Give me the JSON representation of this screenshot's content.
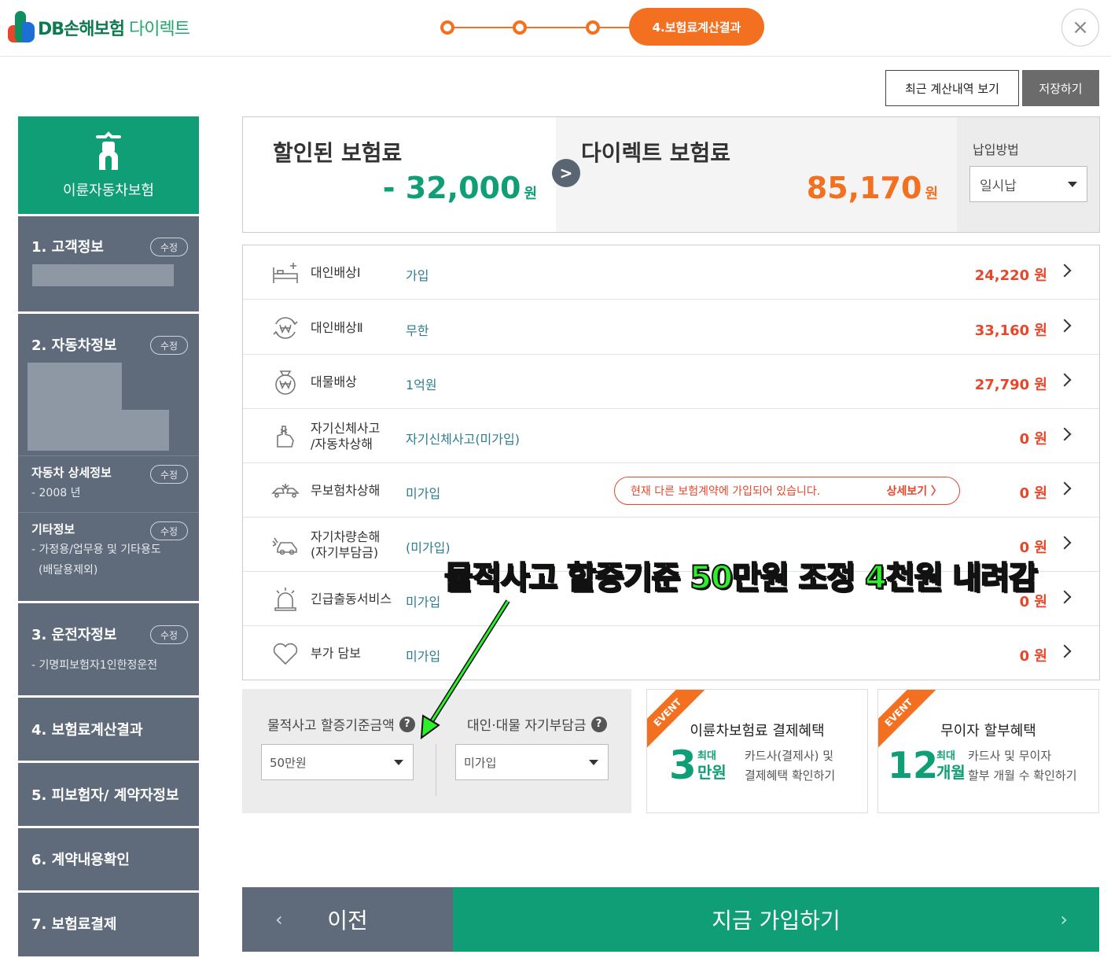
{
  "header": {
    "logo_main": "DB손해보험",
    "logo_sub": "다이렉트",
    "current_step": "4.보험료계산결과",
    "close_label": "×"
  },
  "toolbar": {
    "recent_label": "최근 계산내역 보기",
    "save_label": "저장하기"
  },
  "sidebar": {
    "head_title": "이륜자동차보험",
    "edit_label": "수정",
    "sections": {
      "customer": "1. 고객정보",
      "vehicle": "2. 자동차정보",
      "vehicle_detail": "자동차 상세정보",
      "vehicle_year": "- 2008 년",
      "other": "기타정보",
      "other_line1": "- 가정용/업무용 및 기타용도",
      "other_line2": "(배달용제외)",
      "driver": "3. 운전자정보",
      "driver_value": "- 기명피보험자1인한정운전",
      "result": "4. 보험료계산결과",
      "insured": "5. 피보험자/ 계약자정보",
      "confirm": "6. 계약내용확인",
      "payment": "7. 보험료결제"
    }
  },
  "summary": {
    "discount_label": "할인된 보험료",
    "discount_amount": "- 32,000",
    "direct_label": "다이렉트 보험료",
    "direct_amount": "85,170",
    "unit": "원",
    "arrow": ">",
    "pay_method_label": "납입방법",
    "pay_method_value": "일시납"
  },
  "coverages": [
    {
      "name": "대인배상Ⅰ",
      "value": "가입",
      "amount": "24,220 원",
      "icon": "bed-plus-icon"
    },
    {
      "name": "대인배상Ⅱ",
      "value": "무한",
      "amount": "33,160 원",
      "icon": "won-cycle-icon"
    },
    {
      "name": "대물배상",
      "value": "1억원",
      "amount": "27,790 원",
      "icon": "money-bag-icon"
    },
    {
      "name_line1": "자기신체사고",
      "name_line2": "/자동차상해",
      "value": "자기신체사고(미가입)",
      "amount": "0 원",
      "icon": "hand-bandage-icon"
    },
    {
      "name": "무보험차상해",
      "value": "미가입",
      "amount": "0 원",
      "icon": "car-crash-icon",
      "notice": "현재 다른 보험계약에 가입되어 있습니다.",
      "notice_more": "상세보기 〉"
    },
    {
      "name_line1": "자기차량손해",
      "name_line2": "(자기부담금)",
      "value": "(미가입)",
      "amount": "0 원",
      "icon": "car-damage-icon"
    },
    {
      "name": "긴급출동서비스",
      "value": "미가입",
      "amount": "0 원",
      "icon": "siren-icon"
    },
    {
      "name": "부가 담보",
      "value": "미가입",
      "amount": "0 원",
      "icon": "heart-icon"
    }
  ],
  "options": {
    "property_label": "물적사고 할증기준금액",
    "property_value": "50만원",
    "deductible_label": "대인·대물 자기부담금",
    "deductible_value": "미가입",
    "help": "?"
  },
  "events": [
    {
      "ribbon": "EVENT",
      "title": "이륜차보험료 결제혜택",
      "big": "3",
      "small_top": "최대",
      "small_unit": "만원",
      "desc1": "카드사(결제사) 및",
      "desc2": "결제혜택 확인하기"
    },
    {
      "ribbon": "EVENT",
      "title": "무이자 할부혜택",
      "big": "12",
      "small_top": "최대",
      "small_unit": "개월",
      "desc1": "카드사 및 무이자",
      "desc2": "할부 개월 수 확인하기"
    }
  ],
  "footer": {
    "prev_label": "이전",
    "prev_arrow": "‹",
    "join_label": "지금 가입하기",
    "join_arrow": "›"
  },
  "annotation": "물적사고 할증기준 50만원 조정 4천원 내려감",
  "colors": {
    "brand_green": "#0f9e75",
    "accent_orange": "#f37021",
    "price_red": "#e8462a",
    "sidebar_slate": "#5f6b7a",
    "annotation_green": "#2cf02c"
  }
}
